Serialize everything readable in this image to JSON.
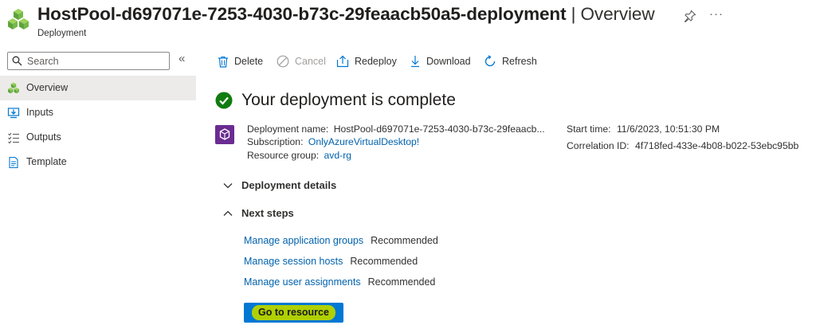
{
  "header": {
    "title_main": "HostPool-d697071e-7253-4030-b73c-29feaacb50a5-deployment",
    "title_suffix": " | Overview",
    "subtitle": "Deployment",
    "more": "···"
  },
  "sidebar": {
    "search_placeholder": "Search",
    "collapse": "«",
    "items": [
      {
        "label": "Overview",
        "icon": "deployment-cubes-icon"
      },
      {
        "label": "Inputs",
        "icon": "inputs-icon"
      },
      {
        "label": "Outputs",
        "icon": "outputs-icon"
      },
      {
        "label": "Template",
        "icon": "template-icon"
      }
    ]
  },
  "toolbar": {
    "delete": "Delete",
    "cancel": "Cancel",
    "redeploy": "Redeploy",
    "download": "Download",
    "refresh": "Refresh"
  },
  "status": {
    "message": "Your deployment is complete"
  },
  "details": {
    "deployment_name_label": "Deployment name:",
    "deployment_name_value": "HostPool-d697071e-7253-4030-b73c-29feaacb...",
    "subscription_label": "Subscription:",
    "subscription_value": "OnlyAzureVirtualDesktop!",
    "resource_group_label": "Resource group:",
    "resource_group_value": "avd-rg",
    "start_time_label": "Start time:",
    "start_time_value": "11/6/2023, 10:51:30 PM",
    "correlation_label": "Correlation ID:",
    "correlation_value": "4f718fed-433e-4b08-b022-53ebc95bb"
  },
  "sections": {
    "deployment_details": "Deployment details",
    "next_steps": "Next steps"
  },
  "next_steps": [
    {
      "link": "Manage application groups",
      "tag": "Recommended"
    },
    {
      "link": "Manage session hosts",
      "tag": "Recommended"
    },
    {
      "link": "Manage user assignments",
      "tag": "Recommended"
    }
  ],
  "go_to_resource": "Go to resource",
  "colors": {
    "accent": "#0078d4",
    "link": "#0062ad",
    "success": "#107c10",
    "highlight": "#b0d000"
  }
}
